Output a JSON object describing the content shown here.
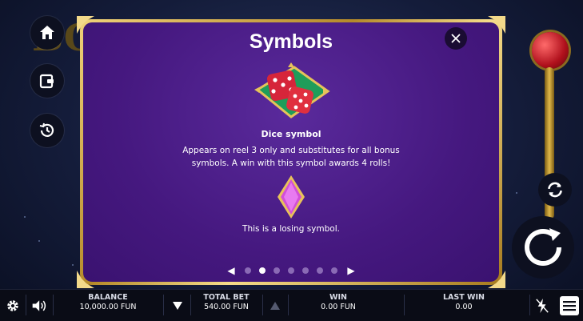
{
  "modal": {
    "title": "Symbols",
    "symbols": [
      {
        "name": "Dice symbol",
        "description": "Appears on reel 3 only and substitutes for all bonus symbols. A win with this symbol awards 4 rolls!",
        "icon": "dice-icon"
      },
      {
        "name": "",
        "description": "This is a losing symbol.",
        "icon": "purple-diamond-icon"
      }
    ],
    "pager": {
      "count": 7,
      "active": 1
    }
  },
  "background": {
    "logo_text": "BON"
  },
  "bottom_bar": {
    "balance_label": "BALANCE",
    "balance_value": "10,000.00 FUN",
    "total_bet_label": "TOTAL BET",
    "total_bet_value": "540.00 FUN",
    "win_label": "WIN",
    "win_value": "0.00 FUN",
    "last_win_label": "LAST WIN",
    "last_win_value": "0.00"
  },
  "colors": {
    "panel_purple": "#45187f",
    "gold": "#d6a940",
    "bar": "#0a0c16"
  }
}
